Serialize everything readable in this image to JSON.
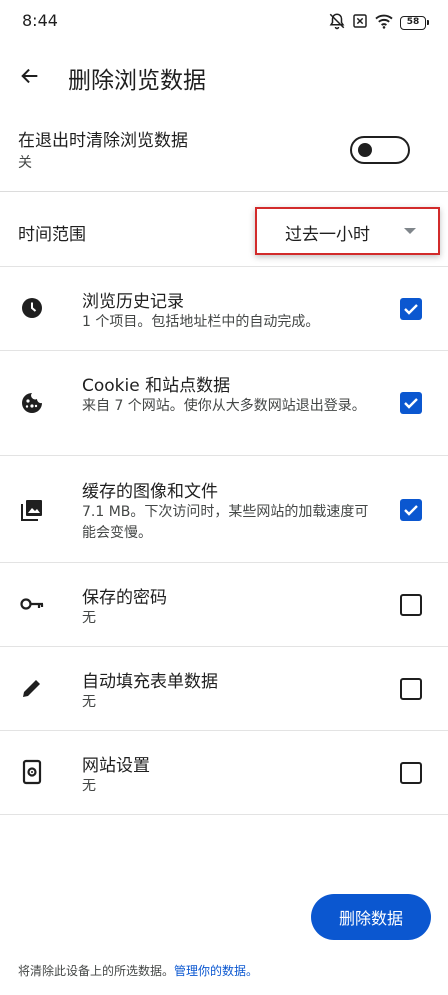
{
  "status_bar": {
    "time": "8:44",
    "battery": "58",
    "icons": [
      "bell-muted-icon",
      "sim-blocked-icon",
      "wifi-icon",
      "battery-icon"
    ]
  },
  "header": {
    "title": "删除浏览数据",
    "back_icon": "arrow-left-icon"
  },
  "exit_setting": {
    "title": "在退出时清除浏览数据",
    "subtitle": "关",
    "enabled": false
  },
  "time_range": {
    "label": "时间范围",
    "selected": "过去一小时",
    "highlight_color": "#d22b2b"
  },
  "items": [
    {
      "title": "浏览历史记录",
      "subtitle": "1 个项目。包括地址栏中的自动完成。",
      "checked": true,
      "icon": "clock-icon"
    },
    {
      "title": "Cookie 和站点数据",
      "subtitle": "来自 7 个网站。使你从大多数网站退出登录。",
      "checked": true,
      "icon": "cookie-icon"
    },
    {
      "title": "缓存的图像和文件",
      "subtitle": "7.1 MB。下次访问时，某些网站的加载速度可能会变慢。",
      "checked": true,
      "icon": "image-icon"
    },
    {
      "title": "保存的密码",
      "subtitle": "无",
      "checked": false,
      "icon": "key-icon"
    },
    {
      "title": "自动填充表单数据",
      "subtitle": "无",
      "checked": false,
      "icon": "pencil-icon"
    },
    {
      "title": "网站设置",
      "subtitle": "无",
      "checked": false,
      "icon": "site-settings-icon"
    }
  ],
  "actions": {
    "delete_label": "删除数据"
  },
  "footer": {
    "text": "将清除此设备上的所选数据。",
    "link": "管理你的数据。"
  },
  "colors": {
    "accent": "#0b57d0",
    "text": "#1f1f1f"
  }
}
